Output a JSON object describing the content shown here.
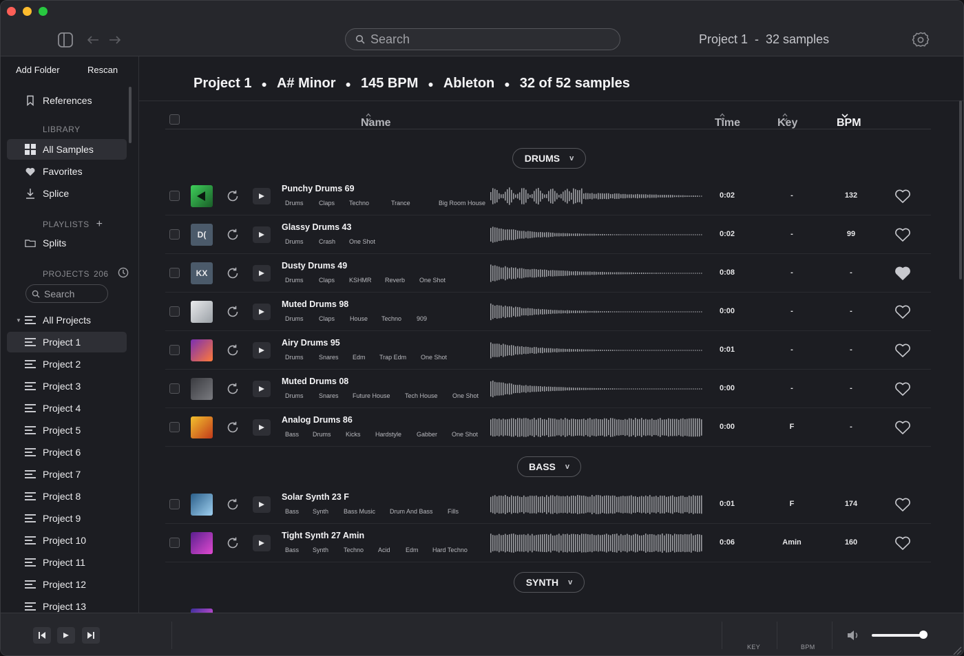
{
  "toolbar": {
    "search_placeholder": "Search",
    "title": "Project 1  -  32 samples",
    "icons": [
      "sidebar-toggle-icon",
      "arrow-left-icon",
      "arrow-right-icon",
      "search-icon",
      "settings-gear-icon"
    ]
  },
  "sidebar": {
    "add_folder": "Add Folder",
    "rescan": "Rescan",
    "references": "References",
    "library_heading": "LIBRARY",
    "library": [
      {
        "label": "All Samples",
        "icon": "grid-icon"
      },
      {
        "label": "Favorites",
        "icon": "heart-icon"
      },
      {
        "label": "Splice",
        "icon": "download-icon"
      }
    ],
    "playlists_heading": "PLAYLISTS",
    "playlists": [
      {
        "label": "Splits",
        "icon": "folder-icon"
      }
    ],
    "projects_heading": "PROJECTS",
    "projects_count": "206",
    "projects_search_placeholder": "Search",
    "all_projects": "All Projects",
    "projects": [
      "Project 1",
      "Project 2",
      "Project 3",
      "Project 4",
      "Project 5",
      "Project 6",
      "Project 7",
      "Project 8",
      "Project 9",
      "Project 10",
      "Project 11",
      "Project 12",
      "Project 13"
    ]
  },
  "main": {
    "header": {
      "project": "Project 1",
      "key": "A# Minor",
      "bpm": "145 BPM",
      "daw": "Ableton",
      "count": "32 of 52 samples"
    },
    "columns": {
      "name": "Name",
      "time": "Time",
      "key": "Key",
      "bpm": "BPM"
    },
    "groups": [
      {
        "label": "DRUMS"
      },
      {
        "label": "BASS"
      },
      {
        "label": "SYNTH"
      }
    ],
    "samples": [
      {
        "name": "Punchy Drums 69",
        "tags": [
          "Drums",
          "Claps",
          "Techno",
          "Trance",
          "Big Room House"
        ],
        "time": "0:02",
        "key": "-",
        "bpm": "132",
        "favorite": false,
        "thumb": "green-art"
      },
      {
        "name": "Glassy Drums 43",
        "tags": [
          "Drums",
          "Crash",
          "One Shot"
        ],
        "time": "0:02",
        "key": "-",
        "bpm": "99",
        "favorite": false,
        "thumb": "D("
      },
      {
        "name": "Dusty Drums 49",
        "tags": [
          "Drums",
          "Claps",
          "KSHMR",
          "Reverb",
          "One Shot"
        ],
        "time": "0:08",
        "key": "-",
        "bpm": "-",
        "favorite": true,
        "thumb": "KX"
      },
      {
        "name": "Muted Drums 98",
        "tags": [
          "Drums",
          "Claps",
          "House",
          "Techno",
          "909"
        ],
        "time": "0:00",
        "key": "-",
        "bpm": "-",
        "favorite": false,
        "thumb": "device-art"
      },
      {
        "name": "Airy Drums 95",
        "tags": [
          "Drums",
          "Snares",
          "Edm",
          "Trap Edm",
          "One Shot"
        ],
        "time": "0:01",
        "key": "-",
        "bpm": "-",
        "favorite": false,
        "thumb": "city-art"
      },
      {
        "name": "Muted Drums 08",
        "tags": [
          "Drums",
          "Snares",
          "Future House",
          "Tech House",
          "One Shot"
        ],
        "time": "0:00",
        "key": "-",
        "bpm": "-",
        "favorite": false,
        "thumb": "dark-art"
      },
      {
        "name": "Analog Drums 86",
        "tags": [
          "Bass",
          "Drums",
          "Kicks",
          "Hardstyle",
          "Gabber",
          "One Shot"
        ],
        "time": "0:00",
        "key": "F",
        "bpm": "-",
        "favorite": false,
        "thumb": "yellow-art"
      },
      {
        "name": "Solar Synth 23 F",
        "tags": [
          "Bass",
          "Synth",
          "Bass Music",
          "Drum And Bass",
          "Fills"
        ],
        "time": "0:01",
        "key": "F",
        "bpm": "174",
        "favorite": false,
        "thumb": "blue-art"
      },
      {
        "name": "Tight Synth 27 Amin",
        "tags": [
          "Bass",
          "Synth",
          "Techno",
          "Acid",
          "Edm",
          "Hard Techno"
        ],
        "time": "0:06",
        "key": "Amin",
        "bpm": "160",
        "favorite": false,
        "thumb": "purple-art"
      }
    ]
  },
  "player": {
    "key_label": "KEY",
    "bpm_label": "BPM",
    "volume": 0.9,
    "icons": [
      "skip-back-icon",
      "play-icon",
      "skip-forward-icon",
      "volume-icon"
    ]
  },
  "colors": {
    "background": "#1c1d22",
    "toolbar": "#26272c",
    "active_item": "#2e2f35",
    "text": "#f4f4f6",
    "muted": "#8a8b90"
  }
}
